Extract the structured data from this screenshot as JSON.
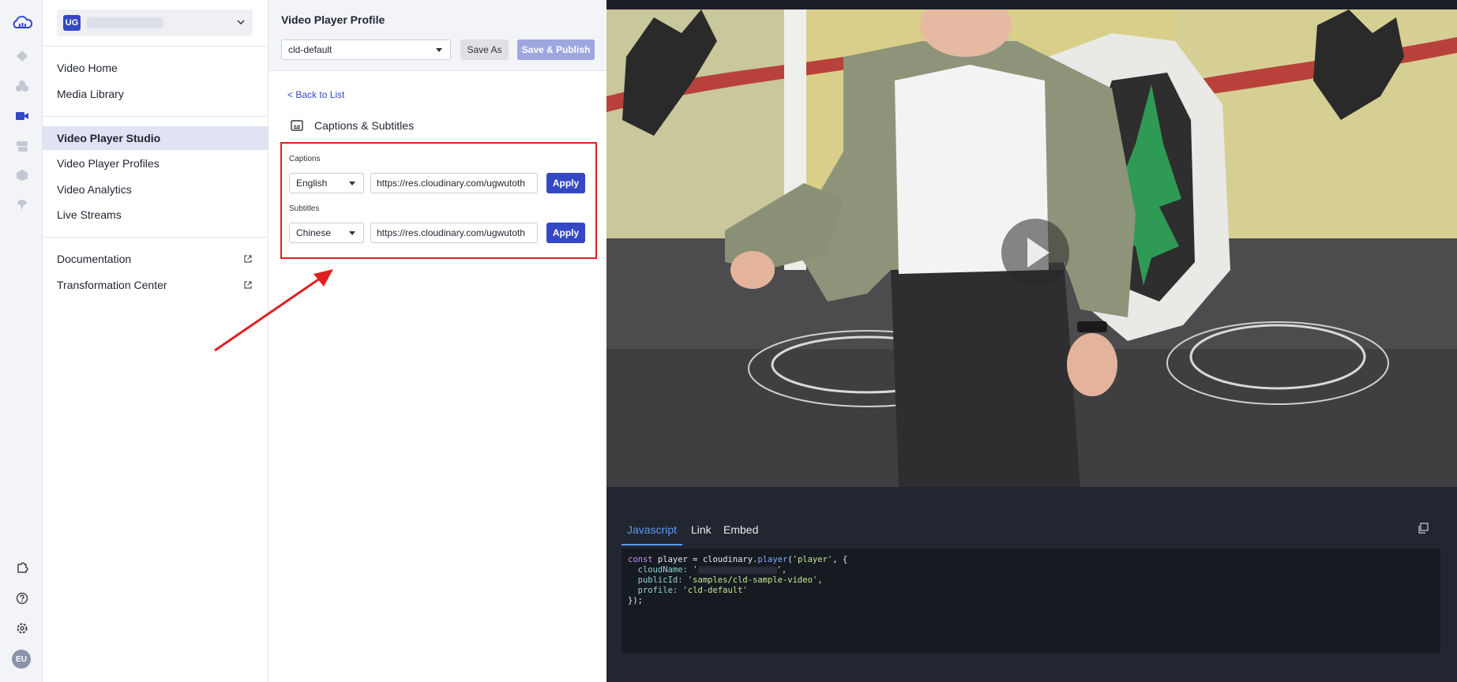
{
  "rail": {
    "icons": [
      "cloud-logo-icon",
      "diamond-icon",
      "assets-icon",
      "video-icon",
      "layers-icon",
      "cube-icon",
      "pin-icon",
      "puzzle-icon",
      "help-icon",
      "settings-icon"
    ],
    "avatar_initials": "EU",
    "accent": "#3448c5"
  },
  "account": {
    "badge": "UG"
  },
  "nav": {
    "group1": [
      "Video Home",
      "Media Library"
    ],
    "group2": [
      "Video Player Studio",
      "Video Player Profiles",
      "Video Analytics",
      "Live Streams"
    ],
    "group3": [
      "Documentation",
      "Transformation Center"
    ],
    "active": "Video Player Studio"
  },
  "profile": {
    "title": "Video Player Profile",
    "selected_profile": "cld-default",
    "save_as": "Save As",
    "save_publish": "Save & Publish",
    "back_link": "< Back to List",
    "section_title": "Captions & Subtitles",
    "captions": {
      "label": "Captions",
      "language": "English",
      "url": "https://res.cloudinary.com/ugwutoth",
      "apply": "Apply"
    },
    "subtitles": {
      "label": "Subtitles",
      "language": "Chinese",
      "url": "https://res.cloudinary.com/ugwutoth",
      "apply": "Apply"
    }
  },
  "code": {
    "tabs": [
      "Javascript",
      "Link",
      "Embed"
    ],
    "active_tab": "Javascript",
    "line1_a": "const",
    "line1_b": " player = cloudinary.",
    "line1_c": "player",
    "line1_d": "(",
    "line1_e": "'player'",
    "line1_f": ", {",
    "line2_key": "  cloudName: ",
    "line2_val_open": "'",
    "line2_val_close": "',",
    "line3_key": "  publicId: ",
    "line3_val": "'samples/cld-sample-video',",
    "line4_key": "  profile: ",
    "line4_val": "'cld-default'",
    "line5": "});"
  }
}
